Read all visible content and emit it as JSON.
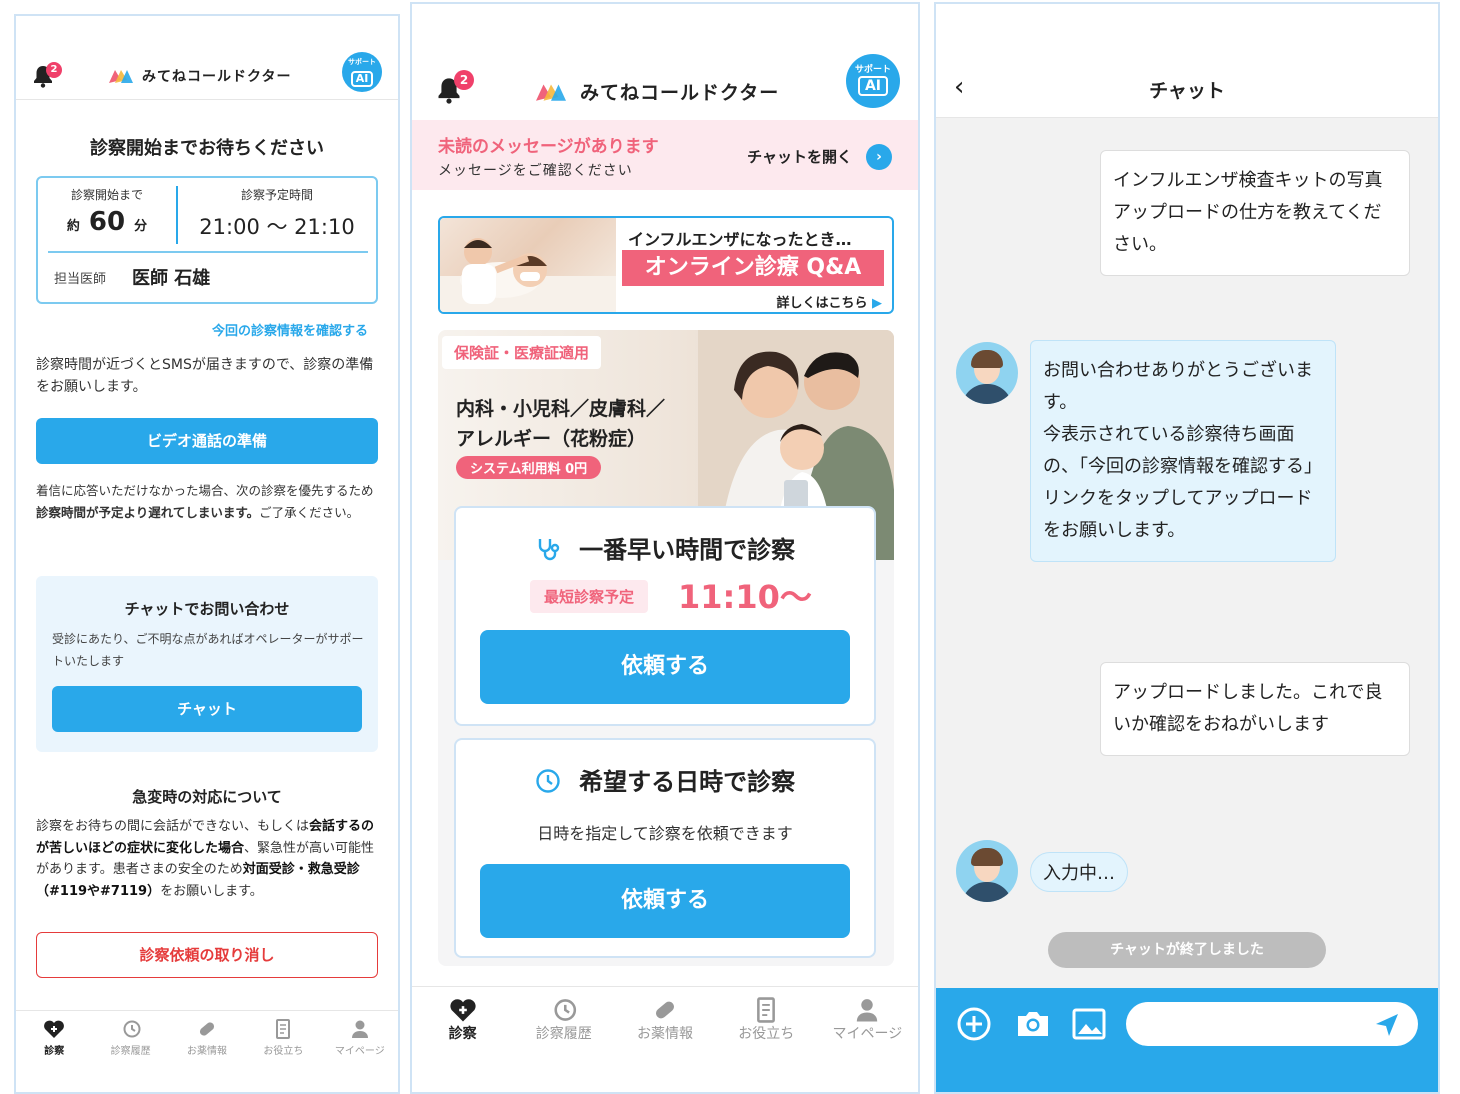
{
  "app": {
    "name": "みてねコールドクター",
    "support_label": "サポート",
    "ai_label": "AI",
    "notification_count": "2",
    "brand_color": "#29a8ea",
    "accent_color": "#f0637b"
  },
  "screen1": {
    "title": "診察開始までお待ちください",
    "until_label": "診察開始まで",
    "until_prefix": "約",
    "until_value": "60",
    "until_unit": "分",
    "scheduled_label": "診察予定時間",
    "scheduled_value": "21:00 〜 21:10",
    "doctor_label": "担当医師",
    "doctor_name": "医師 石雄",
    "info_link": "今回の診察情報を確認する",
    "sms_note": "診察時間が近づくとSMSが届きますので、診察の準備をお願いします。",
    "video_button": "ビデオ通話の準備",
    "missed_note_1": "着信に応答いただけなかった場合、次の診察を優先するため",
    "missed_note_bold": "診察時間が予定より遅れてしまいます。",
    "missed_note_2": "ご了承ください。",
    "chat_card_title": "チャットでお問い合わせ",
    "chat_card_desc": "受診にあたり、ご不明な点があればオペレーターがサポートいたします",
    "chat_button": "チャット",
    "emergency_title": "急変時の対応について",
    "emergency_1": "診察をお待ちの間に会話ができない、もしくは",
    "emergency_bold_1": "会話するのが苦しいほどの症状に変化した場合",
    "emergency_2": "、緊急性が高い可能性があります。患者さまの安全のため",
    "emergency_bold_2": "対面受診・救急受診（#119や#7119）",
    "emergency_3": "をお願いします。",
    "cancel_button": "診察依頼の取り消し"
  },
  "tabs": [
    {
      "label": "診察",
      "icon": "heart-plus-icon"
    },
    {
      "label": "診察履歴",
      "icon": "history-icon"
    },
    {
      "label": "お薬情報",
      "icon": "pill-icon"
    },
    {
      "label": "お役立ち",
      "icon": "document-icon"
    },
    {
      "label": "マイページ",
      "icon": "person-icon"
    }
  ],
  "screen2": {
    "unread_title": "未読のメッセージがあります",
    "unread_sub": "メッセージをご確認ください",
    "open_chat": "チャットを開く",
    "banner_line1": "インフルエンザになったとき…",
    "banner_line2": "オンライン診療 Q&A",
    "banner_more": "詳しくはこちら",
    "insurance_pill": "保険証・医療証適用",
    "departments_1": "内科・小児科／皮膚科／",
    "departments_2": "アレルギー（花粉症）",
    "fee_pill": "システム利用料 0円",
    "earliest_title": "一番早い時間で診察",
    "earliest_label": "最短診察予定",
    "earliest_time": "11:10〜",
    "request_button": "依頼する",
    "preferred_title": "希望する日時で診察",
    "preferred_desc": "日時を指定して診察を依頼できます",
    "request_button_2": "依頼する"
  },
  "screen3": {
    "title": "チャット",
    "msg1": "インフルエンザ検査キットの写真アップロードの仕方を教えてください。",
    "msg2": "お問い合わせありがとうございます。\n今表示されている診察待ち画面の、「今回の診察情報を確認する」リンクをタップしてアップロードをお願いします。",
    "msg3": "アップロードしました。これで良いか確認をおねがいします",
    "typing": "入力中…",
    "ended": "チャットが終了しました"
  }
}
